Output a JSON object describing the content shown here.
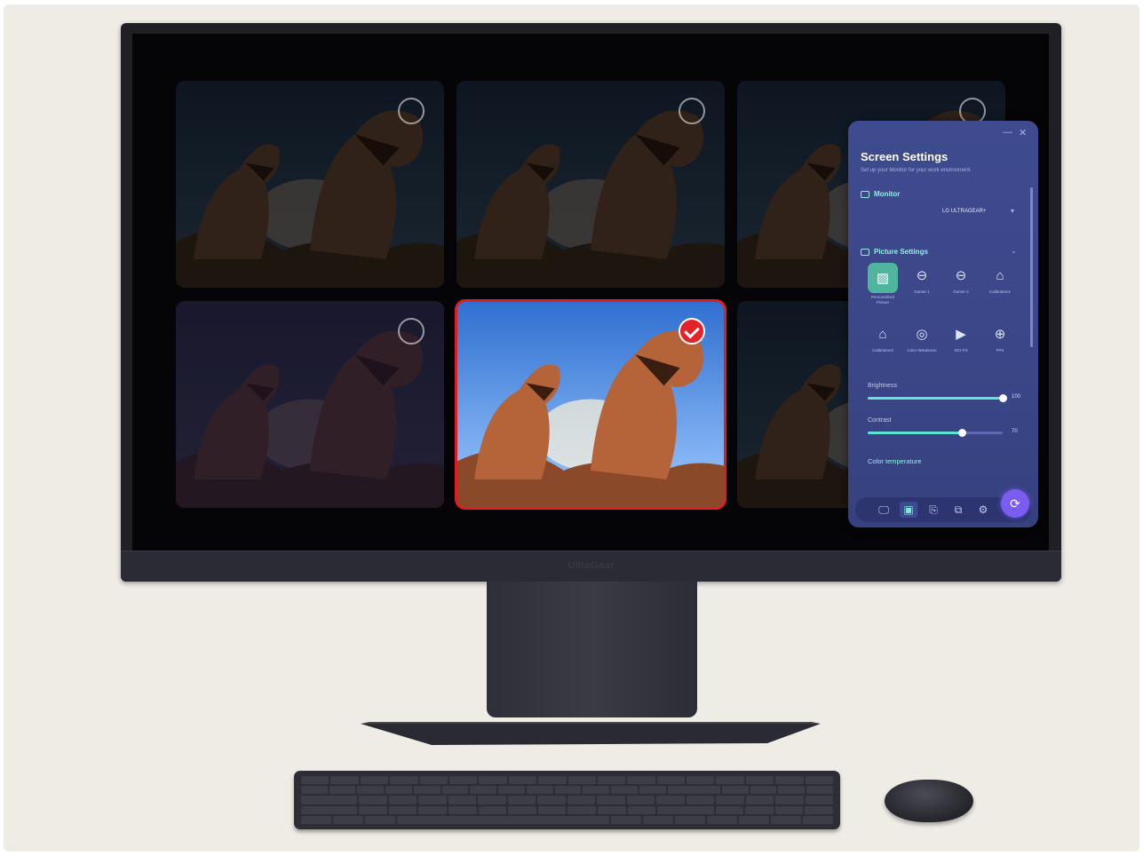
{
  "monitor": {
    "brand_label": "UltraGear"
  },
  "thumbnails": [
    {
      "state": "unselected"
    },
    {
      "state": "unselected"
    },
    {
      "state": "unselected"
    },
    {
      "state": "unselected"
    },
    {
      "state": "selected"
    },
    {
      "state": "unselected"
    }
  ],
  "panel": {
    "title": "Screen Settings",
    "subtitle": "Set up your Monitor for your work environment.",
    "monitor_section": {
      "heading": "Monitor",
      "selected_monitor": "LG ULTRAGEAR+"
    },
    "picture_section": {
      "heading": "Picture Settings",
      "modes": [
        {
          "label": "Personalized Picture",
          "icon": "personalized-picture-icon",
          "active": true
        },
        {
          "label": "Gamer 1",
          "icon": "gamepad-icon",
          "active": false
        },
        {
          "label": "Gamer 2",
          "icon": "gamepad-icon",
          "active": false
        },
        {
          "label": "Calibration1",
          "icon": "calibration-icon",
          "active": false
        },
        {
          "label": "Calibration2",
          "icon": "calibration-icon",
          "active": false
        },
        {
          "label": "Color Weakness",
          "icon": "color-weakness-icon",
          "active": false
        },
        {
          "label": "DCI-P3",
          "icon": "video-icon",
          "active": false
        },
        {
          "label": "FPS",
          "icon": "crosshair-icon",
          "active": false
        }
      ]
    },
    "brightness": {
      "label": "Brightness",
      "value": 100
    },
    "contrast": {
      "label": "Contrast",
      "value": 70
    },
    "color_temperature_label": "Color temperature",
    "dock": [
      "display-settings-icon",
      "picture-icon",
      "input-icon",
      "camera-icon",
      "gear-icon"
    ],
    "colors": {
      "accent": "#8ff0e6",
      "panel_bg": "#3f4b8f",
      "selection": "#e11d24"
    }
  }
}
